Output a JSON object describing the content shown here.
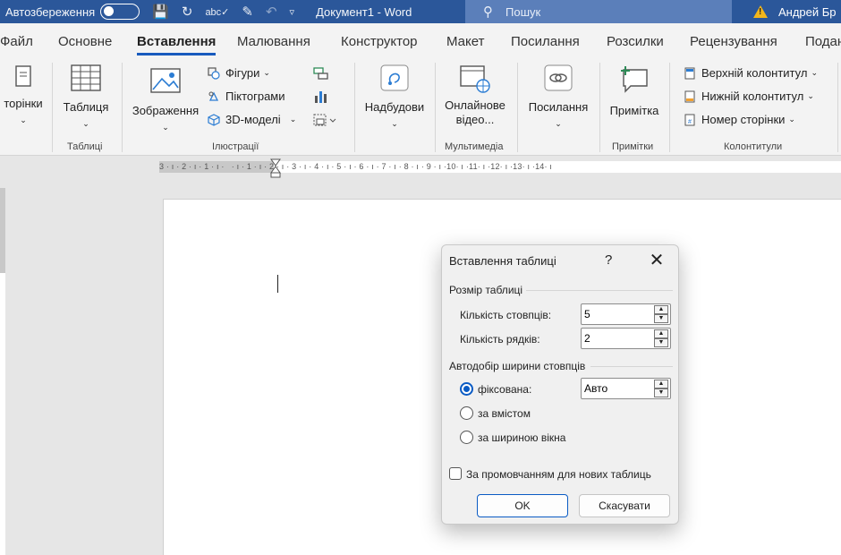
{
  "titlebar": {
    "autosave_label": "Автозбереження",
    "document_name": "Документ1  -  Word",
    "search_placeholder": "Пошук",
    "user_name": "Андрей Бр"
  },
  "tabs": [
    {
      "label": "Файл",
      "active": false
    },
    {
      "label": "Основне",
      "active": false
    },
    {
      "label": "Вставлення",
      "active": true
    },
    {
      "label": "Малювання",
      "active": false
    },
    {
      "label": "Конструктор",
      "active": false
    },
    {
      "label": "Макет",
      "active": false
    },
    {
      "label": "Посилання",
      "active": false
    },
    {
      "label": "Розсилки",
      "active": false
    },
    {
      "label": "Рецензування",
      "active": false
    },
    {
      "label": "Подан",
      "active": false
    }
  ],
  "ribbon": {
    "pages_label": "торінки",
    "table_label": "Таблиця",
    "pictures_label": "Зображення",
    "shapes_label": "Фігури",
    "icons_label": "Піктограми",
    "models3d_label": "3D-моделі",
    "addins_label": "Надбудови",
    "online_video_label1": "Онлайнове",
    "online_video_label2": "відео...",
    "links_label": "Посилання",
    "comment_label": "Примітка",
    "header_label": "Верхній колонтитул",
    "footer_label": "Нижній колонтитул",
    "page_number_label": "Номер сторінки",
    "groups": {
      "tables": "Таблиці",
      "illustrations": "Ілюстрації",
      "media": "Мультимедіа",
      "comments": "Примітки",
      "header_footer": "Колонтитули"
    }
  },
  "ruler_text": "3 · ı · 2 · ı · 1 · ı ·   · ı · 1 · ı · 2 · ı · 3 · ı · 4 · ı · 5 · ı · 6 · ı · 7 · ı · 8 · ı · 9 · ı ·10· ı ·11· ı ·12· ı ·13· ı ·14· ı",
  "dialog": {
    "title": "Вставлення таблиці",
    "help": "?",
    "close": "✕",
    "size_section": "Розмір таблиці",
    "columns_label": "Кількість стовпців:",
    "columns_value": "5",
    "rows_label": "Кількість рядків:",
    "rows_value": "2",
    "autofit_section": "Автодобір ширини стовпців",
    "fixed_label": "фіксована:",
    "fixed_value": "Авто",
    "content_label": "за вмістом",
    "window_label": "за шириною вікна",
    "remember_label": "За промовчанням для нових таблиць",
    "ok_label": "OK",
    "cancel_label": "Скасувати"
  }
}
